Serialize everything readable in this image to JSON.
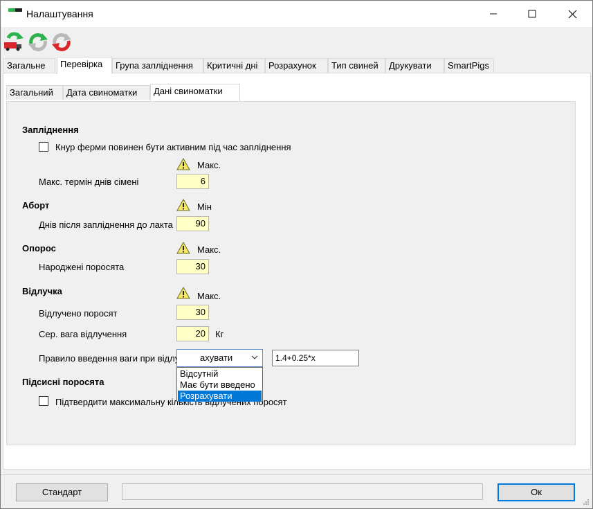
{
  "window": {
    "title": "Налаштування",
    "minimize_glyph": "—",
    "maximize_glyph": "☐",
    "close_glyph": "✕"
  },
  "toolbar": {
    "icons": [
      "truck-sync-icon",
      "arrows-sync-green-icon",
      "arrows-sync-red-icon"
    ]
  },
  "main_tabs": [
    "Загальне",
    "Перевірка",
    "Група запліднення",
    "Критичні дні",
    "Розрахунок",
    "Тип свиней",
    "Друкувати",
    "SmartPigs"
  ],
  "main_tab_active": "Перевірка",
  "sub_tabs": [
    "Загальний",
    "Дата свиноматки",
    "Дані свиноматки"
  ],
  "sub_tab_active": "Дані свиноматки",
  "sections": {
    "insemination": {
      "heading": "Запліднення",
      "boar_checkbox_label": "Кнур ферми повинен бути активним під час запліднення",
      "boar_checked": false,
      "limit_label": "Макс.",
      "max_semen_days_label": "Макс. термін днів сімені",
      "max_semen_days_value": "6"
    },
    "abortion": {
      "heading": "Аборт",
      "limit_label": "Мін",
      "days_after_label": "Днів після запліднення до лакта",
      "days_after_value": "90"
    },
    "farrowing": {
      "heading": "Опорос",
      "limit_label": "Макс.",
      "born_piglets_label": "Народжені поросята",
      "born_piglets_value": "30"
    },
    "weaning": {
      "heading": "Відлучка",
      "limit_label": "Макс.",
      "weaned_piglets_label": "Відлучено поросят",
      "weaned_piglets_value": "30",
      "avg_weight_label": "Сер. вага відлучення",
      "avg_weight_value": "20",
      "avg_weight_unit": "Кг",
      "weight_rule_label": "Правило введення ваги при відлучці",
      "weight_rule_selected": "ахувати",
      "weight_rule_options": [
        "Відсутній",
        "Має бути введено",
        "Розрахувати"
      ],
      "weight_rule_highlighted": "Розрахувати",
      "formula_value": "1.4+0.25*x"
    },
    "suckling": {
      "heading": "Підсисні поросята",
      "confirm_max_label": "Підтвердити максимальну кількість відлучених поросят",
      "confirm_max_checked": false
    }
  },
  "footer": {
    "standard_button": "Стандарт",
    "ok_button": "Ок"
  },
  "colors": {
    "input_bg": "#ffffc6",
    "selection": "#0078d7",
    "warning_fill": "#f5e663",
    "sync_green": "#2bb24c",
    "sync_red": "#d9262a"
  }
}
